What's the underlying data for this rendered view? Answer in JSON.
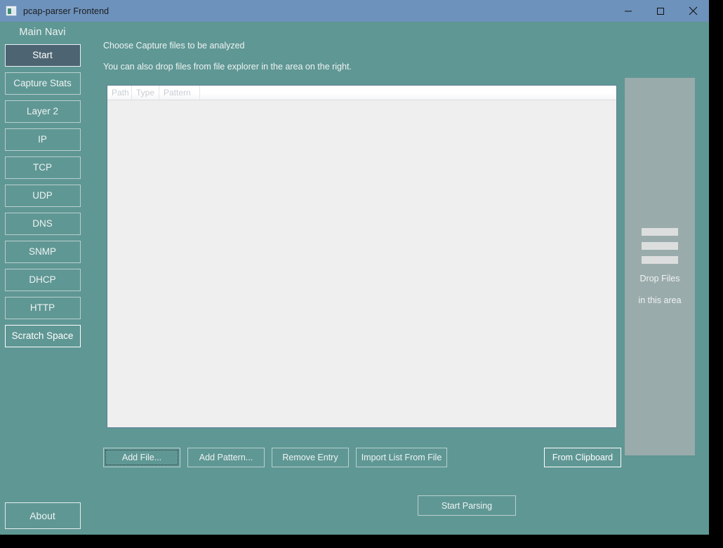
{
  "window": {
    "title": "pcap-parser Frontend",
    "app_icon": "app-window-icon",
    "controls": {
      "minimize": "minimize-icon",
      "maximize": "maximize-icon",
      "close": "close-icon"
    }
  },
  "colors": {
    "titlebar": "#6d92bc",
    "app_background": "#5f9794",
    "selected_nav": "#4d6472",
    "table_background": "#efefef",
    "dropzone": "#9aabab",
    "text_light": "#eef4f3"
  },
  "sidebar": {
    "title": "Main Navi",
    "items": [
      {
        "label": "Start",
        "state": "selected"
      },
      {
        "label": "Capture Stats",
        "state": "normal"
      },
      {
        "label": "Layer 2",
        "state": "normal"
      },
      {
        "label": "IP",
        "state": "normal"
      },
      {
        "label": "TCP",
        "state": "normal"
      },
      {
        "label": "UDP",
        "state": "normal"
      },
      {
        "label": "DNS",
        "state": "normal"
      },
      {
        "label": "SNMP",
        "state": "normal"
      },
      {
        "label": "DHCP",
        "state": "normal"
      },
      {
        "label": "HTTP",
        "state": "normal"
      },
      {
        "label": "Scratch Space",
        "state": "hover"
      }
    ],
    "about": "About"
  },
  "main": {
    "hint_primary": "Choose Capture files to be analyzed",
    "hint_secondary": "You can also drop files from file explorer in the area on the right.",
    "table": {
      "columns": [
        "Path",
        "Type",
        "Pattern"
      ],
      "rows": []
    },
    "dropzone": {
      "icon": "file-list-icon",
      "line1": "Drop Files",
      "line2": "in this area"
    },
    "buttons": {
      "add_file": "Add File...",
      "add_pattern": "Add Pattern...",
      "remove_entry": "Remove Entry",
      "import_list": "Import List From File",
      "from_clipboard": "From Clipboard",
      "start_parsing": "Start Parsing"
    }
  }
}
